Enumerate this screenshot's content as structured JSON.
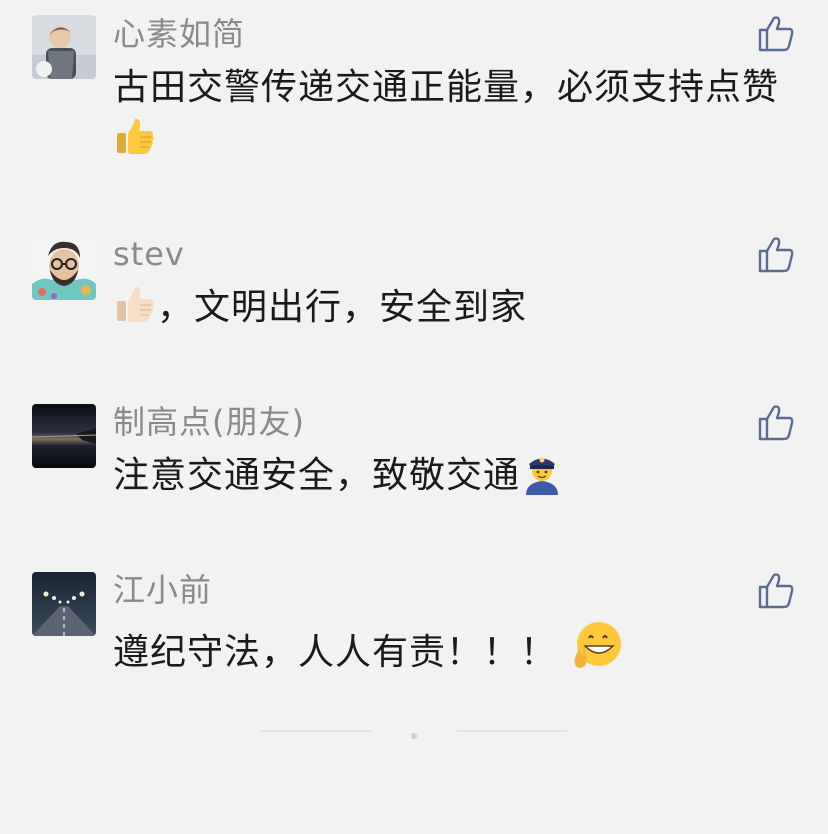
{
  "comments": [
    {
      "name": "心素如简",
      "text_parts": [
        "古田交警传递交通正能量，必须支持点赞"
      ],
      "avatar": "child-photo-avatar",
      "emoji": [
        "thumbs-up-emoji"
      ]
    },
    {
      "name": "stev",
      "text_parts": [
        "，文明出行，安全到家"
      ],
      "avatar": "bearded-man-illustration-avatar",
      "emoji": [
        "thumbs-up-light-emoji"
      ]
    },
    {
      "name": "制高点(朋友)",
      "text_parts": [
        "注意交通安全，致敬交通"
      ],
      "avatar": "night-sky-photo-avatar",
      "emoji": [
        "police-officer-emoji"
      ]
    },
    {
      "name": "江小前",
      "text_parts": [
        "遵纪守法，人人有责！！！"
      ],
      "avatar": "highway-night-photo-avatar",
      "emoji": [
        "victory-grin-emoji"
      ]
    }
  ],
  "like_icon": "thumbs-up-outline-icon",
  "colors": {
    "background": "#f2f2f2",
    "name": "#8a8a8a",
    "text": "#1a1a1a",
    "like_icon": "#5b6b95"
  }
}
